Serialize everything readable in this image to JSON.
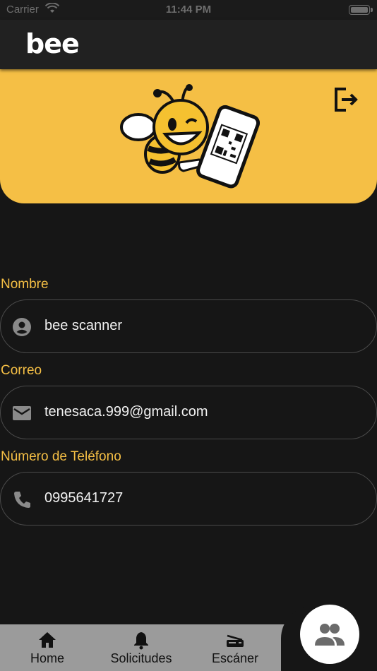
{
  "status_bar": {
    "carrier": "Carrier",
    "time": "11:44 PM"
  },
  "app_bar": {
    "logo": "bee"
  },
  "header": {
    "background_color": "#f5bf45",
    "logout_icon": "logout-icon",
    "illustration": "bee-mascot-with-qr-phone"
  },
  "profile": {
    "name_label": "Nombre",
    "name_value": "bee scanner",
    "name_icon": "account-circle-icon",
    "email_label": "Correo",
    "email_value": "tenesaca.999@gmail.com",
    "email_icon": "mail-icon",
    "phone_label": "Número de Teléfono",
    "phone_value": "0995641727",
    "phone_icon": "phone-icon"
  },
  "bottom_nav": {
    "items": [
      {
        "label": "Home",
        "icon": "home-icon"
      },
      {
        "label": "Solicitudes",
        "icon": "bell-icon"
      },
      {
        "label": "Escáner",
        "icon": "scanner-icon"
      }
    ],
    "active_icon": "people-icon"
  },
  "colors": {
    "accent": "#f5bf45",
    "background": "#161616",
    "nav_background": "#9b9b9b"
  }
}
